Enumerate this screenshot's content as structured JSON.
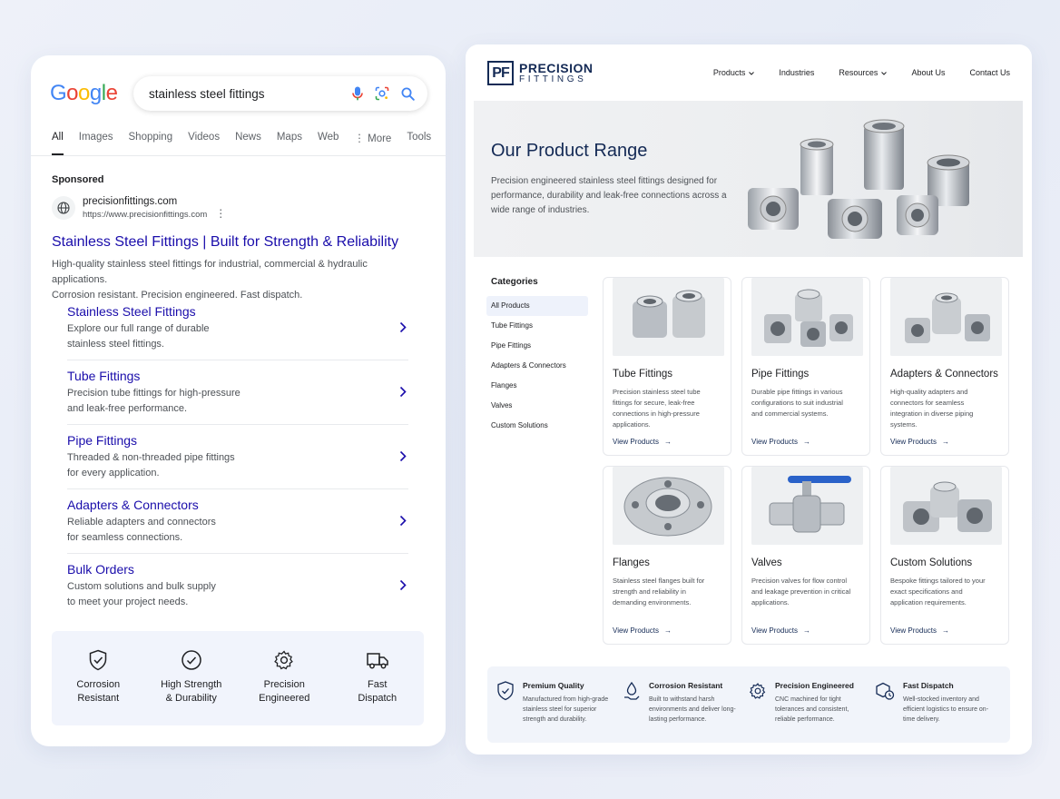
{
  "google": {
    "logo_letters": [
      {
        "char": "G",
        "color": "#4285F4"
      },
      {
        "char": "o",
        "color": "#EA4335"
      },
      {
        "char": "o",
        "color": "#FBBC05"
      },
      {
        "char": "g",
        "color": "#4285F4"
      },
      {
        "char": "l",
        "color": "#34A853"
      },
      {
        "char": "e",
        "color": "#EA4335"
      }
    ],
    "search": {
      "query": "stainless steel fittings"
    },
    "tabs": [
      "All",
      "Images",
      "Shopping",
      "Videos",
      "News",
      "Maps",
      "Web",
      "⋮ More",
      "Tools"
    ],
    "active_tab": "All",
    "sponsored_label": "Sponsored",
    "ad": {
      "site_name": "precisionfittings.com",
      "site_url": "https://www.precisionfittings.com",
      "title": "Stainless Steel Fittings | Built for Strength & Reliability",
      "desc_line1": "High-quality stainless steel fittings for industrial, commercial & hydraulic applications.",
      "desc_line2": "Corrosion resistant. Precision engineered. Fast dispatch."
    },
    "sitelinks": [
      {
        "title": "Stainless Steel Fittings",
        "desc1": "Explore our full range of durable",
        "desc2": "stainless steel fittings."
      },
      {
        "title": "Tube Fittings",
        "desc1": "Precision tube fittings for high-pressure",
        "desc2": "and leak-free performance."
      },
      {
        "title": "Pipe Fittings",
        "desc1": "Threaded & non-threaded pipe fittings",
        "desc2": "for every application."
      },
      {
        "title": "Adapters & Connectors",
        "desc1": "Reliable adapters and connectors",
        "desc2": "for seamless connections."
      },
      {
        "title": "Bulk Orders",
        "desc1": "Custom solutions and bulk supply",
        "desc2": "to meet your project needs."
      }
    ],
    "features": [
      {
        "line1": "Corrosion",
        "line2": "Resistant",
        "icon": "shield-icon"
      },
      {
        "line1": "High Strength",
        "line2": "& Durability",
        "icon": "check-circle-icon"
      },
      {
        "line1": "Precision",
        "line2": "Engineered",
        "icon": "gear-icon"
      },
      {
        "line1": "Fast",
        "line2": "Dispatch",
        "icon": "truck-icon"
      }
    ]
  },
  "site": {
    "logo_mark": "PF",
    "logo_word1": "PRECISION",
    "logo_word2": "FITTINGS",
    "nav": [
      {
        "label": "Products",
        "dropdown": true
      },
      {
        "label": "Industries",
        "dropdown": false
      },
      {
        "label": "Resources",
        "dropdown": true
      },
      {
        "label": "About Us",
        "dropdown": false
      },
      {
        "label": "Contact Us",
        "dropdown": false
      }
    ],
    "hero": {
      "title": "Our Product Range",
      "text": "Precision engineered stainless steel fittings designed for performance, durability and leak-free connections across a wide range of industries."
    },
    "categories_title": "Categories",
    "categories": [
      "All Products",
      "Tube Fittings",
      "Pipe Fittings",
      "Adapters & Connectors",
      "Flanges",
      "Valves",
      "Custom Solutions"
    ],
    "active_category": "All Products",
    "products": [
      {
        "title": "Tube Fittings",
        "desc": "Precision stainless steel tube fittings for secure, leak-free connections in high-pressure applications.",
        "link": "View Products",
        "image": "union-fittings-icon"
      },
      {
        "title": "Pipe Fittings",
        "desc": "Durable pipe fittings in various configurations to suit industrial and commercial systems.",
        "link": "View Products",
        "image": "pipe-fittings-icon"
      },
      {
        "title": "Adapters & Connectors",
        "desc": "High-quality adapters and connectors for seamless integration in diverse piping systems.",
        "link": "View Products",
        "image": "adapter-fittings-icon"
      },
      {
        "title": "Flanges",
        "desc": "Stainless steel flanges built for strength and reliability in demanding environments.",
        "link": "View Products",
        "image": "flange-icon"
      },
      {
        "title": "Valves",
        "desc": "Precision valves for flow control and leakage prevention in critical applications.",
        "link": "View Products",
        "image": "ball-valve-icon"
      },
      {
        "title": "Custom Solutions",
        "desc": "Bespoke fittings tailored to your exact specifications and application requirements.",
        "link": "View Products",
        "image": "custom-fittings-icon"
      }
    ],
    "features": [
      {
        "title": "Premium Quality",
        "desc": "Manufactured from high-grade stainless steel for superior strength and durability.",
        "icon": "shield-check-icon"
      },
      {
        "title": "Corrosion Resistant",
        "desc": "Built to withstand harsh environments and deliver long-lasting performance.",
        "icon": "drop-hand-icon"
      },
      {
        "title": "Precision Engineered",
        "desc": "CNC machined for tight tolerances and consistent, reliable performance.",
        "icon": "gear-icon"
      },
      {
        "title": "Fast Dispatch",
        "desc": "Well-stocked inventory and efficient logistics to ensure on-time delivery.",
        "icon": "box-clock-icon"
      }
    ]
  }
}
